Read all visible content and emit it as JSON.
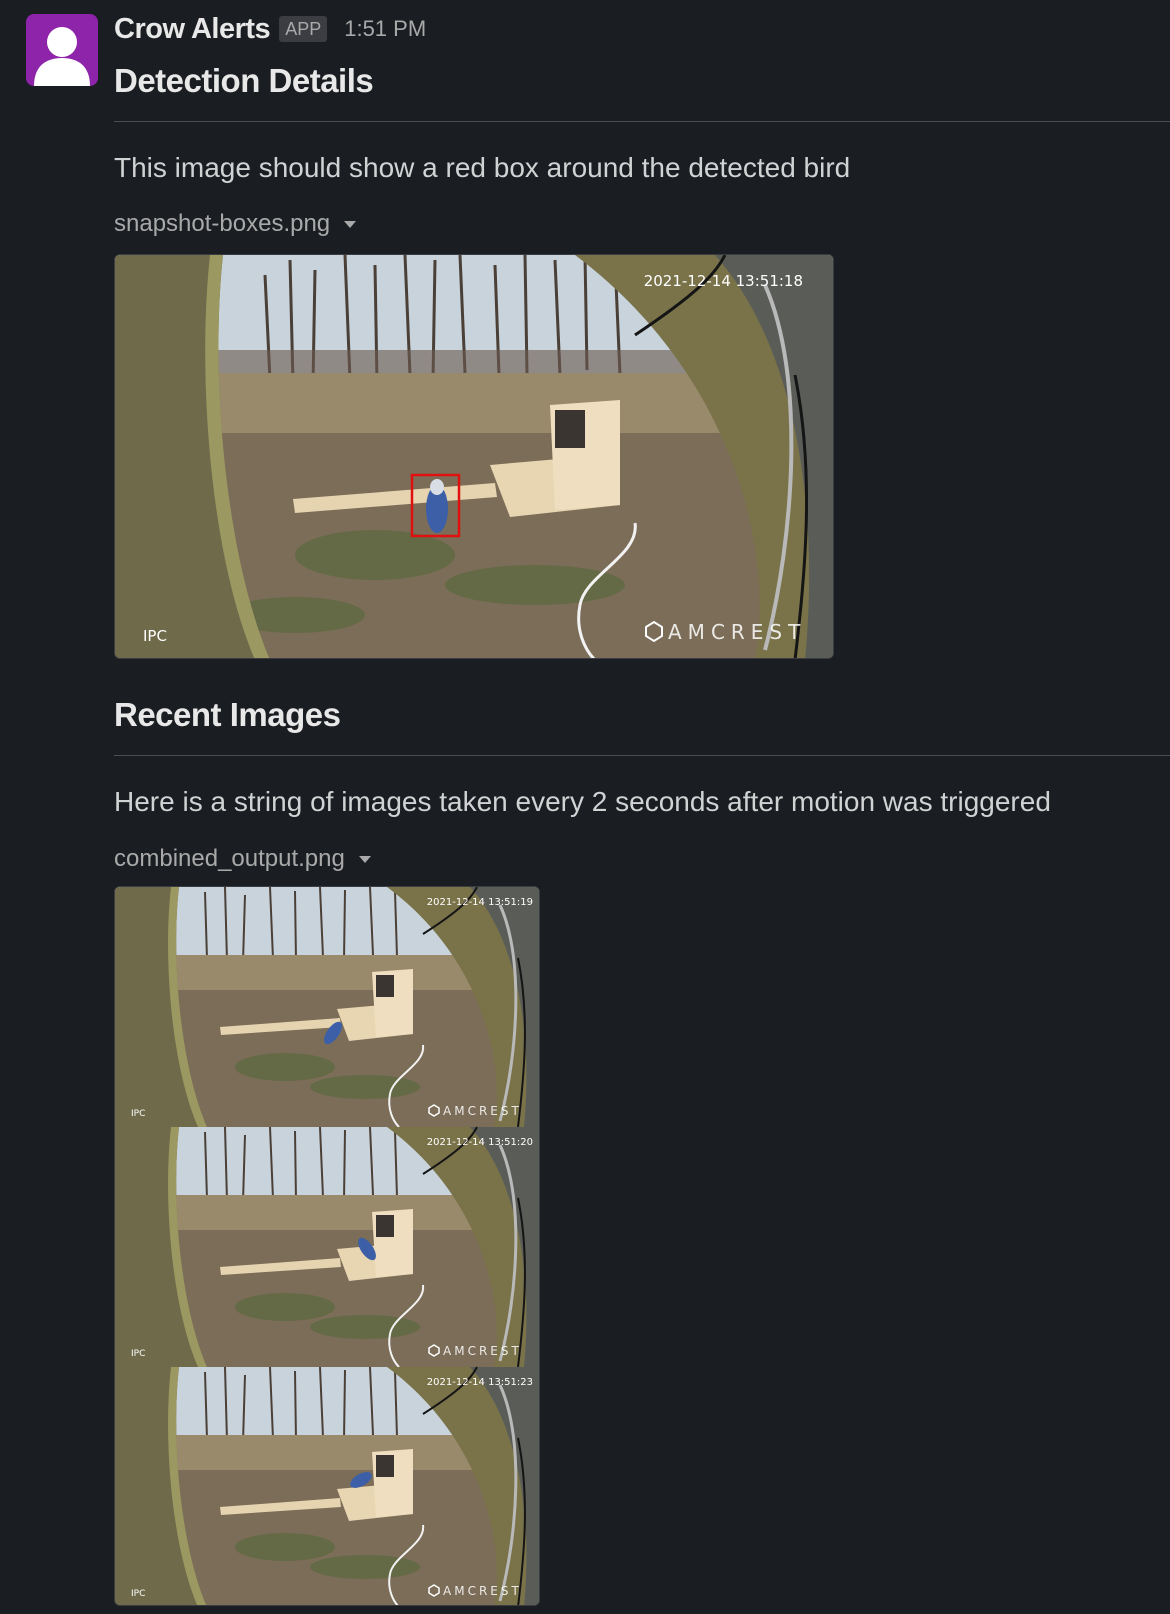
{
  "message": {
    "sender": "Crow Alerts",
    "badge": "APP",
    "time": "1:51 PM"
  },
  "detection": {
    "title": "Detection Details",
    "text": "This image should show a red box around the detected bird",
    "file_name": "snapshot-boxes.png",
    "overlay": {
      "timestamp": "2021-12-14 13:51:18",
      "channel": "IPC",
      "brand": "AMCREST"
    }
  },
  "recent": {
    "title": "Recent Images",
    "text": "Here is a string of images taken every 2 seconds after motion was triggered",
    "file_name": "combined_output.png",
    "frames": [
      {
        "timestamp": "2021-12-14 13:51:19",
        "channel": "IPC",
        "brand": "AMCREST"
      },
      {
        "timestamp": "2021-12-14 13:51:20",
        "channel": "IPC",
        "brand": "AMCREST"
      },
      {
        "timestamp": "2021-12-14 13:51:23",
        "channel": "IPC",
        "brand": "AMCREST"
      }
    ]
  },
  "colors": {
    "background": "#1a1d21",
    "avatar": "#8e24aa",
    "detection_box": "#e01010"
  },
  "icons": {
    "avatar": "user-silhouette-icon",
    "file_menu": "caret-down-icon",
    "brand_logo": "amcrest-logo-icon"
  }
}
